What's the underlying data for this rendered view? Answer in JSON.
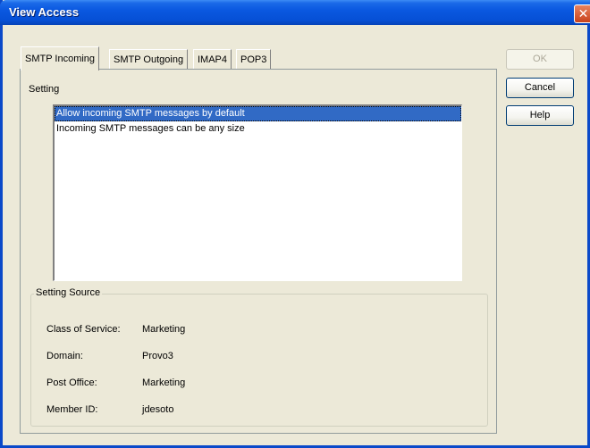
{
  "window": {
    "title": "View Access",
    "close_symbol": "✕"
  },
  "tabs": [
    {
      "label": "SMTP Incoming",
      "active": true
    },
    {
      "label": "SMTP Outgoing",
      "active": false
    },
    {
      "label": "IMAP4",
      "active": false
    },
    {
      "label": "POP3",
      "active": false
    }
  ],
  "setting": {
    "label": "Setting",
    "items": [
      {
        "text": "Allow incoming SMTP messages by default",
        "selected": true
      },
      {
        "text": "Incoming SMTP messages can be any size",
        "selected": false
      }
    ]
  },
  "setting_source": {
    "legend": "Setting Source",
    "rows": [
      {
        "label": "Class of Service:",
        "value": "Marketing"
      },
      {
        "label": "Domain:",
        "value": "Provo3"
      },
      {
        "label": "Post Office:",
        "value": "Marketing"
      },
      {
        "label": "Member ID:",
        "value": "jdesoto"
      }
    ]
  },
  "buttons": {
    "ok": "OK",
    "cancel": "Cancel",
    "help": "Help"
  },
  "colors": {
    "titlebar": "#0a58e0",
    "selection": "#316ac5",
    "face": "#ece9d8"
  }
}
